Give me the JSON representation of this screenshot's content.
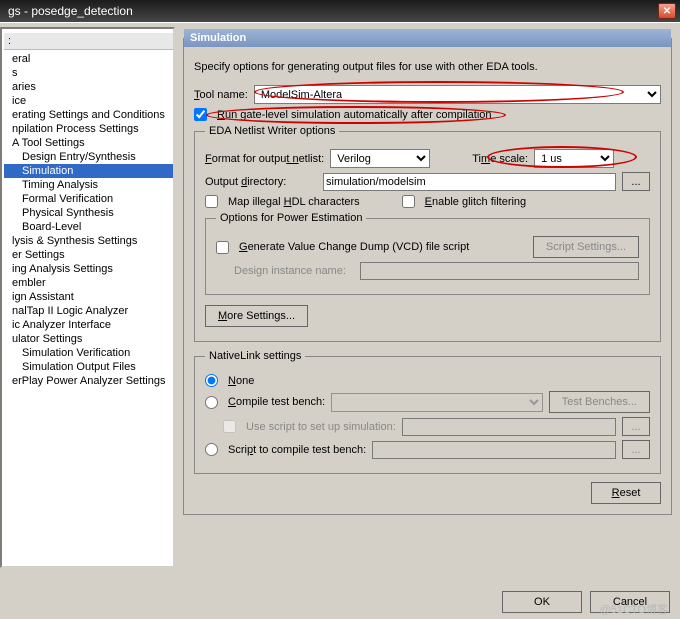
{
  "title": "gs - posedge_detection",
  "tree_header": ":",
  "tree": [
    {
      "label": "eral",
      "indent": false
    },
    {
      "label": "s",
      "indent": false
    },
    {
      "label": "aries",
      "indent": false
    },
    {
      "label": "ice",
      "indent": false
    },
    {
      "label": "erating Settings and Conditions",
      "indent": false
    },
    {
      "label": "npilation Process Settings",
      "indent": false
    },
    {
      "label": "A Tool Settings",
      "indent": false
    },
    {
      "label": "Design Entry/Synthesis",
      "indent": true
    },
    {
      "label": "Simulation",
      "indent": true,
      "selected": true
    },
    {
      "label": "Timing Analysis",
      "indent": true
    },
    {
      "label": "Formal Verification",
      "indent": true
    },
    {
      "label": "Physical Synthesis",
      "indent": true
    },
    {
      "label": "Board-Level",
      "indent": true
    },
    {
      "label": "lysis & Synthesis Settings",
      "indent": false
    },
    {
      "label": "er Settings",
      "indent": false
    },
    {
      "label": "ing Analysis Settings",
      "indent": false
    },
    {
      "label": "embler",
      "indent": false
    },
    {
      "label": "ign Assistant",
      "indent": false
    },
    {
      "label": "nalTap II Logic Analyzer",
      "indent": false
    },
    {
      "label": "ic Analyzer Interface",
      "indent": false
    },
    {
      "label": "ulator Settings",
      "indent": false
    },
    {
      "label": "Simulation Verification",
      "indent": true
    },
    {
      "label": "Simulation Output Files",
      "indent": true
    },
    {
      "label": "erPlay Power Analyzer Settings",
      "indent": false
    }
  ],
  "panel": {
    "title": "Simulation",
    "intro": "Specify options for generating output files for use with other EDA tools.",
    "tool_name_label": "Tool name:",
    "tool_name_value": "ModelSim-Altera",
    "run_gate_label": "Run gate-level simulation automatically after compilation",
    "run_gate_checked": true,
    "netlist_legend": "EDA Netlist Writer options",
    "format_label": "Format for output netlist:",
    "format_value": "Verilog",
    "timescale_label": "Time scale:",
    "timescale_value": "1 us",
    "outdir_label": "Output directory:",
    "outdir_value": "simulation/modelsim",
    "browse_btn": "...",
    "map_hdl_label": "Map illegal HDL characters",
    "glitch_label": "Enable glitch filtering",
    "power_legend": "Options for Power Estimation",
    "vcd_label": "Generate Value Change Dump (VCD) file script",
    "script_settings_btn": "Script Settings...",
    "design_instance_label": "Design instance name:",
    "more_settings_btn": "More Settings...",
    "nativelink_legend": "NativeLink settings",
    "none_label": "None",
    "compile_tb_label": "Compile test bench:",
    "tb_btn": "Test Benches...",
    "use_script_label": "Use script to set up simulation:",
    "script_compile_label": "Script to compile test bench:",
    "reset_btn": "Reset"
  },
  "buttons": {
    "ok": "OK",
    "cancel": "Cancel"
  },
  "watermark": "@51CTO博客"
}
